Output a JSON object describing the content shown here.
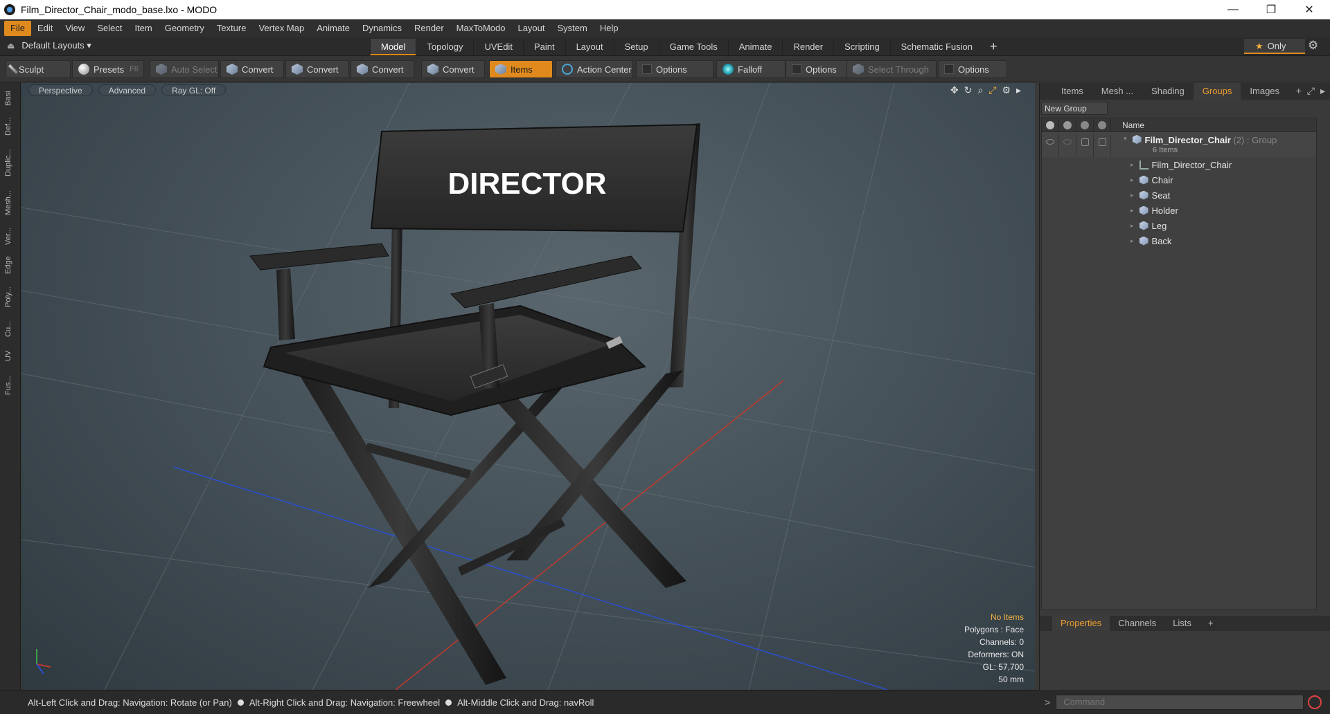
{
  "window": {
    "title": "Film_Director_Chair_modo_base.lxo - MODO",
    "controls": [
      "—",
      "❐",
      "✕"
    ]
  },
  "menu": [
    "File",
    "Edit",
    "View",
    "Select",
    "Item",
    "Geometry",
    "Texture",
    "Vertex Map",
    "Animate",
    "Dynamics",
    "Render",
    "MaxToModo",
    "Layout",
    "System",
    "Help"
  ],
  "layoutbar": {
    "layout_selector": "Default Layouts ▾",
    "tabs": [
      "Model",
      "Topology",
      "UVEdit",
      "Paint",
      "Layout",
      "Setup",
      "Game Tools",
      "Animate",
      "Render",
      "Scripting",
      "Schematic Fusion"
    ],
    "active_tab": "Model",
    "plus": "+",
    "only": "Only"
  },
  "toolbar": {
    "sculpt": "Sculpt",
    "presets": "Presets",
    "presets_key": "F6",
    "auto_select": "Auto Select",
    "convert": "Convert",
    "items": "Items",
    "action_center": "Action Center",
    "options": "Options",
    "falloff": "Falloff",
    "select_through": "Select Through"
  },
  "left_strip": [
    "Basi",
    "Def...",
    "Duplic...",
    "Mesh...",
    "Ver...",
    "Edge",
    "Poly...",
    "Cu...",
    "UV",
    "Fus..."
  ],
  "viewport": {
    "buttons": [
      "Perspective",
      "Advanced",
      "Ray GL: Off"
    ],
    "chair_label": "DIRECTOR",
    "hud": {
      "selection": "No Items",
      "polygons": "Polygons : Face",
      "channels": "Channels: 0",
      "deformers": "Deformers: ON",
      "gl": "GL: 57,700",
      "lens": "50 mm"
    }
  },
  "status": {
    "hint1": "Alt-Left Click and Drag: Navigation: Rotate (or Pan)",
    "hint2": "Alt-Right Click and Drag: Navigation: Freewheel",
    "hint3": "Alt-Middle Click and Drag: navRoll"
  },
  "right_panel": {
    "tabs": [
      "Items",
      "Mesh ...",
      "Shading",
      "Groups",
      "Images"
    ],
    "active_tab": "Groups",
    "new_group": "New Group",
    "name_header": "Name",
    "group": {
      "name": "Film_Director_Chair",
      "meta": "(2) : Group",
      "count": "6 Items"
    },
    "children": [
      {
        "name": "Film_Director_Chair",
        "type": "locator"
      },
      {
        "name": "Chair",
        "type": "mesh"
      },
      {
        "name": "Seat",
        "type": "mesh"
      },
      {
        "name": "Holder",
        "type": "mesh"
      },
      {
        "name": "Leg",
        "type": "mesh"
      },
      {
        "name": "Back",
        "type": "mesh"
      }
    ],
    "bottom_tabs": [
      "Properties",
      "Channels",
      "Lists"
    ],
    "bottom_active": "Properties"
  },
  "command": {
    "prompt": ">",
    "placeholder": "Command"
  },
  "colors": {
    "accent": "#e08a1e",
    "x_axis": "#c0392b",
    "z_axis": "#2b4fcf"
  }
}
